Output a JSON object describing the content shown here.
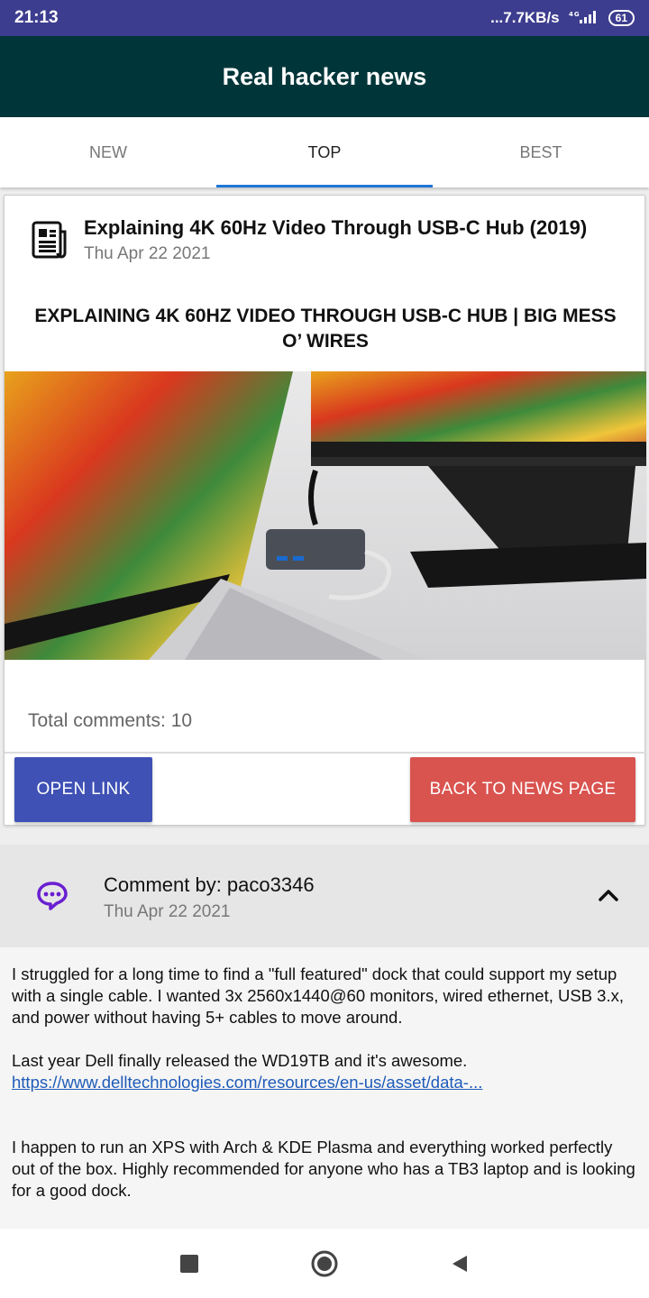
{
  "status": {
    "time": "21:13",
    "network_speed": "...7.7KB/s",
    "signal": "4G",
    "battery": "61"
  },
  "app": {
    "title": "Real hacker news"
  },
  "tabs": [
    {
      "label": "NEW",
      "active": false
    },
    {
      "label": "TOP",
      "active": true
    },
    {
      "label": "BEST",
      "active": false
    }
  ],
  "story": {
    "icon": "newspaper-icon",
    "title": "Explaining 4K 60Hz Video Through USB-C Hub (2019)",
    "date": "Thu Apr 22 2021",
    "headline": "EXPLAINING 4K 60HZ VIDEO THROUGH USB-C HUB | BIG MESS O’ WIRES",
    "total_comments": "Total comments: 10",
    "open_link_label": "OPEN LINK",
    "back_label": "BACK TO NEWS PAGE",
    "open_color": "#3f51b5",
    "back_color": "#d9534f"
  },
  "comment": {
    "icon": "chat-bubble-icon",
    "by": "Comment by: paco3346",
    "date": "Thu Apr 22 2021",
    "collapse_icon": "chevron-up-icon",
    "paragraph1": "I struggled for a long time to find a \"full featured\" dock that could support my setup with a single cable. I wanted 3x 2560x1440@60 monitors, wired ethernet, USB 3.x, and power without having 5+ cables to move around.",
    "paragraph2": "Last year Dell finally released the WD19TB and it's awesome.",
    "link": "https://www.delltechnologies.com/resources/en-us/asset/data-...",
    "paragraph3": "I happen to run an XPS with Arch & KDE Plasma and everything worked perfectly out of the box. Highly recommended for anyone who has a TB3 laptop and is looking for a good dock."
  },
  "colors": {
    "status_bar": "#3d3d8f",
    "app_bar": "#00363a",
    "tab_indicator": "#1e77d6",
    "chat_icon": "#6a1fd1"
  },
  "navigation": {
    "square": "recent-apps-icon",
    "circle": "home-icon",
    "triangle": "back-icon"
  }
}
